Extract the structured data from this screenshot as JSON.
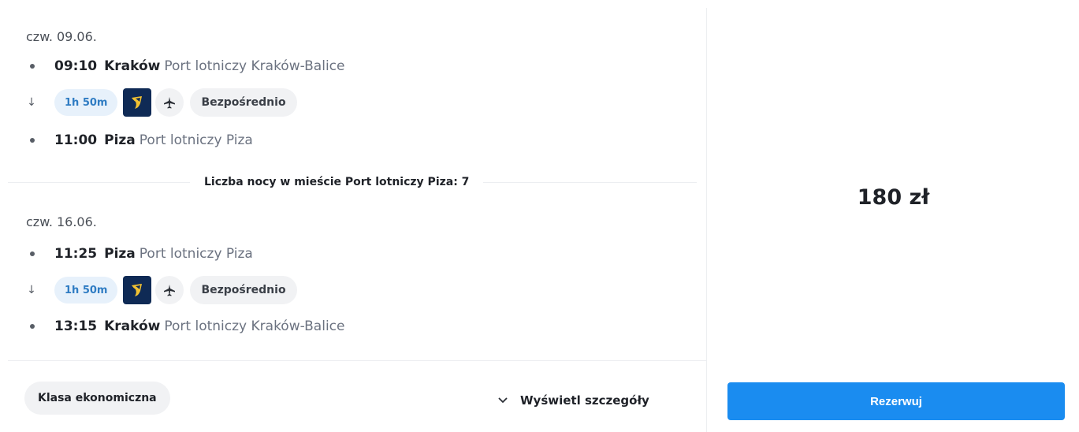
{
  "outbound": {
    "date": "czw. 09.06.",
    "departure": {
      "time": "09:10",
      "city": "Kraków",
      "airport": "Port lotniczy Kraków-Balice"
    },
    "duration": "1h 50m",
    "airline_logo": "ryanair-harp-logo",
    "stops": "Bezpośrednio",
    "arrival": {
      "time": "11:00",
      "city": "Piza",
      "airport": "Port lotniczy Piza"
    }
  },
  "nights_label": "Liczba nocy w mieście Port lotniczy Piza: 7",
  "return": {
    "date": "czw. 16.06.",
    "departure": {
      "time": "11:25",
      "city": "Piza",
      "airport": "Port lotniczy Piza"
    },
    "duration": "1h 50m",
    "airline_logo": "ryanair-harp-logo",
    "stops": "Bezpośrednio",
    "arrival": {
      "time": "13:15",
      "city": "Kraków",
      "airport": "Port lotniczy Kraków-Balice"
    }
  },
  "footer": {
    "cabin_class": "Klasa ekonomiczna",
    "details_label": "Wyświetl szczegóły"
  },
  "booking": {
    "price": "180 zł",
    "reserve_label": "Rezerwuj"
  },
  "colors": {
    "accent": "#1a8cf0",
    "duration_bg": "#e7f1fb",
    "duration_text": "#2f7cc3",
    "logo_bg": "#0f2a55"
  }
}
